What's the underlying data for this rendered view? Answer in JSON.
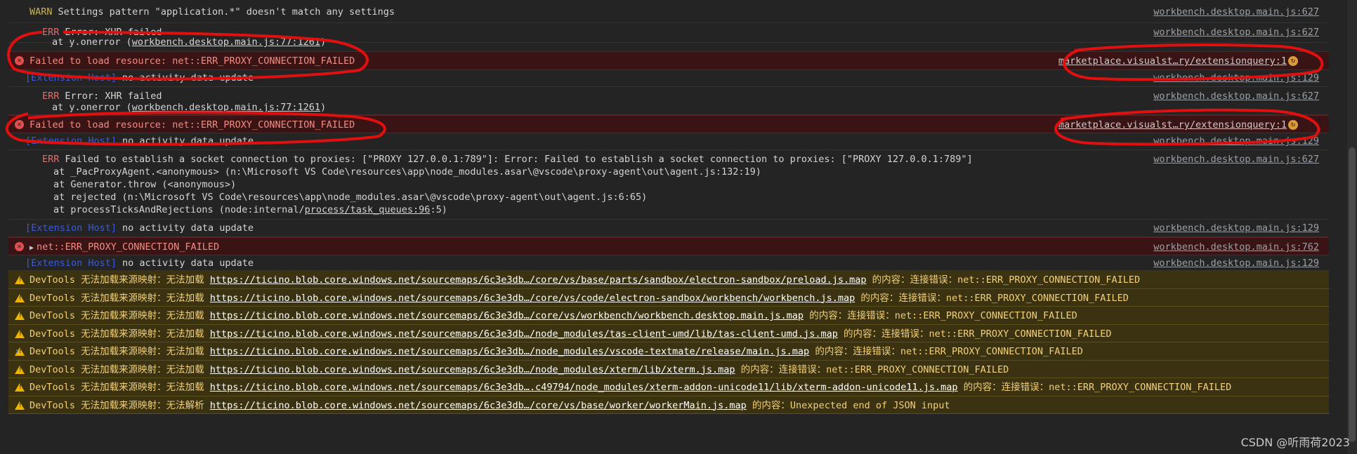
{
  "messages": {
    "warn_settings": {
      "level": "WARN",
      "text": "Settings pattern \"application.*\" doesn't match any settings",
      "source": "workbench.desktop.main.js:627"
    },
    "err_xhr_1": {
      "level": "ERR",
      "text": "Error: XHR failed",
      "stack_prefix": "at y.onerror (",
      "stack_link": "workbench.desktop.main.js:77:1261",
      "stack_suffix": ")",
      "source": "workbench.desktop.main.js:627"
    },
    "fail_1": {
      "text": "Failed to load resource: net::ERR_PROXY_CONNECTION_FAILED",
      "source": "marketplace.visualst…ry/extensionquery:1"
    },
    "ext_host_1": {
      "badge": "[Extension Host]",
      "text": "no activity data update",
      "source": "workbench.desktop.main.js:129"
    },
    "err_xhr_2": {
      "level": "ERR",
      "text": "Error: XHR failed",
      "stack_prefix": "at y.onerror (",
      "stack_link": "workbench.desktop.main.js:77:1261",
      "stack_suffix": ")",
      "source": "workbench.desktop.main.js:627"
    },
    "fail_2": {
      "text": "Failed to load resource: net::ERR_PROXY_CONNECTION_FAILED",
      "source": "marketplace.visualst…ry/extensionquery:1"
    },
    "ext_host_2": {
      "badge": "[Extension Host]",
      "text": "no activity data update",
      "source": "workbench.desktop.main.js:129"
    },
    "err_socket": {
      "level": "ERR",
      "text": "Failed to establish a socket connection to proxies: [\"PROXY 127.0.0.1:789\"]: Error: Failed to establish a socket connection to proxies: [\"PROXY 127.0.0.1:789\"]",
      "stack": [
        "at _PacProxyAgent.<anonymous> (n:\\Microsoft VS Code\\resources\\app\\node_modules.asar\\@vscode\\proxy-agent\\out\\agent.js:132:19)",
        "at Generator.throw (<anonymous>)",
        "at rejected (n:\\Microsoft VS Code\\resources\\app\\node_modules.asar\\@vscode\\proxy-agent\\out\\agent.js:6:65)"
      ],
      "stack_last_prefix": "at processTicksAndRejections (node:internal/",
      "stack_last_link": "process/task_queues:96",
      "stack_last_suffix": ":5)",
      "source": "workbench.desktop.main.js:627"
    },
    "ext_host_3": {
      "badge": "[Extension Host]",
      "text": "no activity data update",
      "source": "workbench.desktop.main.js:129"
    },
    "net_err": {
      "text": "net::ERR_PROXY_CONNECTION_FAILED",
      "source": "workbench.desktop.main.js:762"
    },
    "ext_host_4": {
      "badge": "[Extension Host]",
      "text": "no activity data update",
      "source": "workbench.desktop.main.js:129"
    }
  },
  "devtools_warnings": [
    {
      "prefix": "DevTools 无法加载来源映射：无法加载 ",
      "url": "https://ticino.blob.core.windows.net/sourcemaps/6c3e3db…/core/vs/base/parts/sandbox/electron-sandbox/preload.js.map",
      "suffix": " 的内容：连接错误：net::ERR_PROXY_CONNECTION_FAILED"
    },
    {
      "prefix": "DevTools 无法加载来源映射：无法加载 ",
      "url": "https://ticino.blob.core.windows.net/sourcemaps/6c3e3db…/core/vs/code/electron-sandbox/workbench/workbench.js.map",
      "suffix": " 的内容：连接错误：net::ERR_PROXY_CONNECTION_FAILED"
    },
    {
      "prefix": "DevTools 无法加载来源映射：无法加载 ",
      "url": "https://ticino.blob.core.windows.net/sourcemaps/6c3e3db…/core/vs/workbench/workbench.desktop.main.js.map",
      "suffix": " 的内容：连接错误：net::ERR_PROXY_CONNECTION_FAILED"
    },
    {
      "prefix": "DevTools 无法加载来源映射：无法加载 ",
      "url": "https://ticino.blob.core.windows.net/sourcemaps/6c3e3db…/node_modules/tas-client-umd/lib/tas-client-umd.js.map",
      "suffix": " 的内容：连接错误：net::ERR_PROXY_CONNECTION_FAILED"
    },
    {
      "prefix": "DevTools 无法加载来源映射：无法加载 ",
      "url": "https://ticino.blob.core.windows.net/sourcemaps/6c3e3db…/node_modules/vscode-textmate/release/main.js.map",
      "suffix": " 的内容：连接错误：net::ERR_PROXY_CONNECTION_FAILED"
    },
    {
      "prefix": "DevTools 无法加载来源映射：无法加载 ",
      "url": "https://ticino.blob.core.windows.net/sourcemaps/6c3e3db…/node_modules/xterm/lib/xterm.js.map",
      "suffix": " 的内容：连接错误：net::ERR_PROXY_CONNECTION_FAILED"
    },
    {
      "prefix": "DevTools 无法加载来源映射：无法加载 ",
      "url": "https://ticino.blob.core.windows.net/sourcemaps/6c3e3db….c49794/node_modules/xterm-addon-unicode11/lib/xterm-addon-unicode11.js.map",
      "suffix": " 的内容：连接错误：net::ERR_PROXY_CONNECTION_FAILED"
    },
    {
      "prefix": "DevTools 无法加载来源映射：无法解析 ",
      "url": "https://ticino.blob.core.windows.net/sourcemaps/6c3e3db…/core/vs/base/worker/workerMain.js.map",
      "suffix": " 的内容：Unexpected end of JSON input"
    }
  ],
  "prompt_symbol": "›",
  "watermark": "CSDN @听雨荷2023",
  "icons": {
    "error": "error-circle-icon",
    "warning": "warning-triangle-icon",
    "retry": "retry-icon",
    "expand": "expand-triangle-icon"
  },
  "colors": {
    "background": "#242424",
    "error_bg": "#3a1414",
    "warning_bg": "#3a3210",
    "error_text": "#f28b82",
    "warning_text": "#f3d079",
    "annotation": "#e01010"
  }
}
